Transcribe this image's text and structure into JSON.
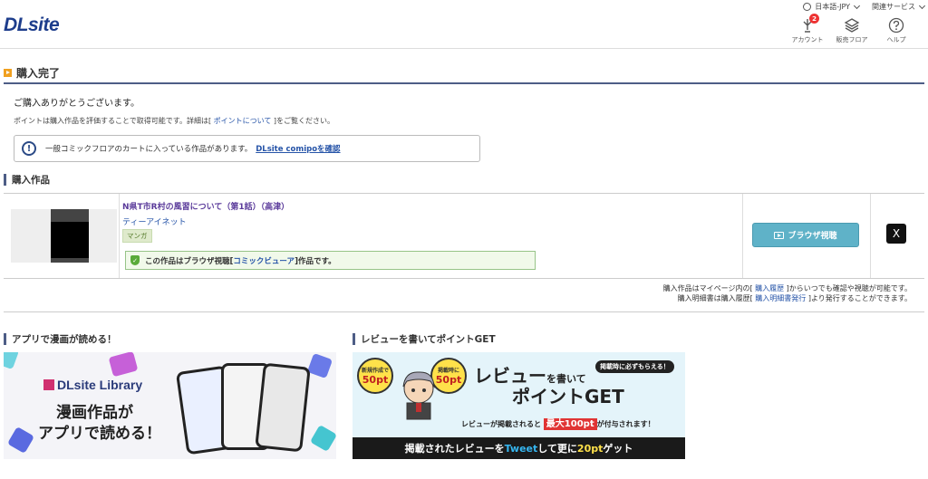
{
  "header": {
    "logo": "DLsite",
    "language": "日本語-JPY",
    "related": "関連サービス",
    "icons": [
      {
        "name": "account",
        "label": "アカウント",
        "badge": "2"
      },
      {
        "name": "floor",
        "label": "販売フロア"
      },
      {
        "name": "help",
        "label": "ヘルプ"
      }
    ]
  },
  "page": {
    "title": "購入完了",
    "thanks": "ご購入ありがとうございます。",
    "points_before": "ポイントは購入作品を評価することで取得可能です。詳細は[ ",
    "points_link": "ポイントについて",
    "points_after": " ]をご覧ください。",
    "notice_text": "一般コミックフロアのカートに入っている作品があります。",
    "notice_link": "DLsite comipoを確認"
  },
  "purchased": {
    "heading": "購入作品",
    "item": {
      "title": "N県T市R村の風習について（第1話）（高津）",
      "circle": "ティーアイネット",
      "genre": "マンガ",
      "browser_before": "この作品はブラウザ視聴[ ",
      "browser_link": "コミックビューア",
      "browser_after": " ]作品です。",
      "button": "ブラウザ視聴",
      "share_icon": "X"
    },
    "history1_before": "購入作品はマイページ内の[ ",
    "history1_link": "購入履歴",
    "history1_after": " ]からいつでも確認や視聴が可能です。",
    "history2_before": "購入明細書は購入履歴[ ",
    "history2_link": "購入明細書発行",
    "history2_after": " ]より発行することができます。"
  },
  "banners": {
    "app": {
      "heading": "アプリで漫画が読める！",
      "brand": "DLsite Library",
      "line1": "漫画作品が",
      "line2": "アプリで読める！"
    },
    "review": {
      "heading": "レビューを書いてポイントGET",
      "pt1_small": "新規作成で",
      "pt1": "50pt",
      "pt2_small": "掲載時に",
      "pt2": "50pt",
      "tag": "掲載時に必ずもらえる！",
      "title1": "レビュー",
      "title1_small": "を書いて",
      "title2": "ポイントGET",
      "sub_before": "レビューが掲載されると",
      "sub_red": "最大100pt",
      "sub_after": "が付与されます！",
      "bottom_before": "掲載されたレビューを",
      "bottom_tw": "Tweet",
      "bottom_mid": "して更に",
      "bottom_y": "20pt",
      "bottom_after": "ゲット"
    }
  }
}
